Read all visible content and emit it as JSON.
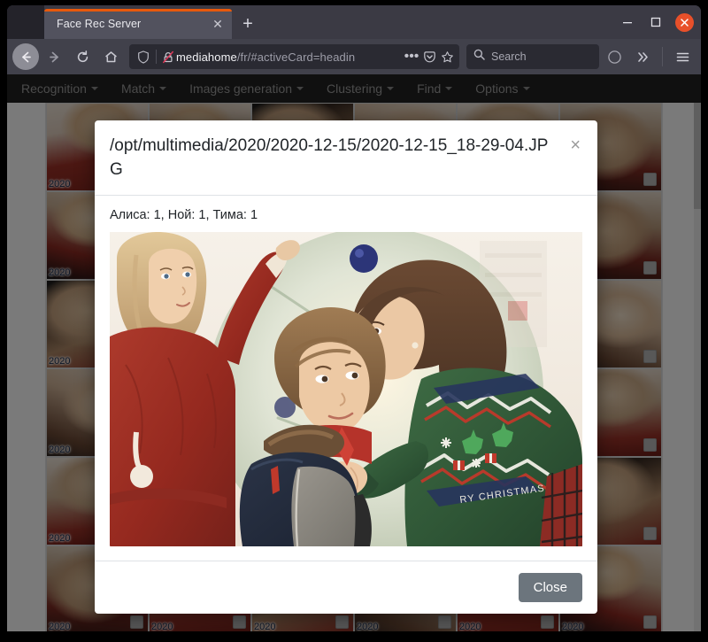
{
  "browser": {
    "tab": {
      "title": "Face Rec Server",
      "close_label": "✕"
    },
    "new_tab_label": "+",
    "window_controls": {
      "minimize_label": "–",
      "maximize_label": "☐",
      "close_label": "✕"
    },
    "nav": {
      "back_label": "←",
      "forward_label": "→",
      "reload_label": "⟳",
      "home_label": "⌂"
    },
    "url": {
      "host": "mediahome",
      "path": "/fr/#activeCard=headin",
      "full": "mediahome/fr/#activeCard=headin",
      "page_actions_label": "•••",
      "pocket_label": "⬡",
      "bookmark_label": "☆"
    },
    "search": {
      "placeholder": "Search"
    },
    "toolbar": {
      "account_label": "◯",
      "overflow_label": "»",
      "menu_label": "☰"
    }
  },
  "app": {
    "navbar_items": [
      {
        "label": "Recognition"
      },
      {
        "label": "Match"
      },
      {
        "label": "Images generation"
      },
      {
        "label": "Clustering"
      },
      {
        "label": "Find"
      },
      {
        "label": "Options"
      }
    ],
    "cards": [
      {
        "year": "2020",
        "thumb": "t-a"
      },
      {
        "year": "2020",
        "thumb": "t-b"
      },
      {
        "year": "2020",
        "thumb": "t-c"
      },
      {
        "year": "2020",
        "thumb": "t-d"
      },
      {
        "year": "2020",
        "thumb": "t-e"
      },
      {
        "year": "2020",
        "thumb": "t-f"
      },
      {
        "year": "2020",
        "thumb": "t-b"
      },
      {
        "year": "2020",
        "thumb": "t-c"
      },
      {
        "year": "2020",
        "thumb": "t-a"
      },
      {
        "year": "2020",
        "thumb": "t-e"
      },
      {
        "year": "2020",
        "thumb": "t-d"
      },
      {
        "year": "2020",
        "thumb": "t-f"
      },
      {
        "year": "2020",
        "thumb": "t-c"
      },
      {
        "year": "2020",
        "thumb": "t-a"
      },
      {
        "year": "2020",
        "thumb": "t-f"
      },
      {
        "year": "2020",
        "thumb": "t-b"
      },
      {
        "year": "2020",
        "thumb": "t-e"
      },
      {
        "year": "2020",
        "thumb": "t-d"
      },
      {
        "year": "2020",
        "thumb": "t-d"
      },
      {
        "year": "2020",
        "thumb": "t-f"
      },
      {
        "year": "2020",
        "thumb": "t-b"
      },
      {
        "year": "2020",
        "thumb": "t-a"
      },
      {
        "year": "2020",
        "thumb": "t-c"
      },
      {
        "year": "2020",
        "thumb": "t-e"
      },
      {
        "year": "2020",
        "thumb": "t-e"
      },
      {
        "year": "2020",
        "thumb": "t-d"
      },
      {
        "year": "2020",
        "thumb": "t-a"
      },
      {
        "year": "2020",
        "thumb": "t-f"
      },
      {
        "year": "2020",
        "thumb": "t-b"
      },
      {
        "year": "2020",
        "thumb": "t-c"
      },
      {
        "year": "2020",
        "thumb": "t-f"
      },
      {
        "year": "2020",
        "thumb": "t-e"
      },
      {
        "year": "2020",
        "thumb": "t-c"
      },
      {
        "year": "2020",
        "thumb": "t-d"
      },
      {
        "year": "2020",
        "thumb": "t-a"
      },
      {
        "year": "2020",
        "thumb": "t-b"
      }
    ]
  },
  "modal": {
    "title": "/opt/multimedia/2020/2020-12-15/2020-12-15_18-29-04.JPG",
    "close_icon_label": "×",
    "face_counts": "Алиса: 1, Ной: 1, Тима: 1",
    "photo_alt": "Three children decorating a Christmas tree; girl in red sweater hanging an ornament, woman in green Christmas sweater kissing a boy's head",
    "close_button_label": "Close"
  },
  "colors": {
    "accent_tab": "#e8590c",
    "window_close": "#e8502a",
    "chrome_tabstrip": "#3b3a44",
    "chrome_toolbar": "#41414b",
    "app_navbar": "#222222",
    "btn_secondary": "#6c757d",
    "modal_bg": "#ffffff",
    "overlay": "rgba(0,0,0,0.52)"
  }
}
